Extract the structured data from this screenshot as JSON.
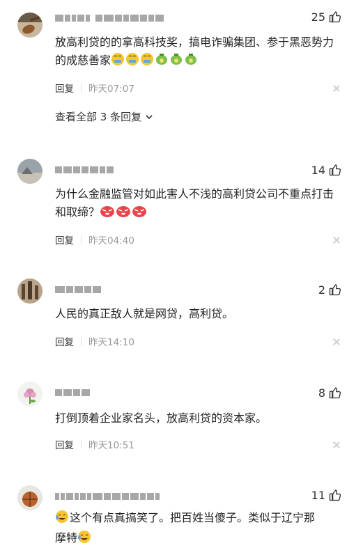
{
  "comments": [
    {
      "likes": "25",
      "text": "放高利贷的的拿高科技奖，搞电诈骗集团、参于黑恶势力的成慈善家",
      "reply_label": "回复",
      "time": "昨天07:07",
      "view_all_label": "查看全部 3 条回复"
    },
    {
      "likes": "14",
      "text": "为什么金融监管对如此害人不浅的高利贷公司不重点打击和取缔？",
      "reply_label": "回复",
      "time": "昨天04:40"
    },
    {
      "likes": "2",
      "text": "人民的真正敌人就是网贷，高利贷。",
      "reply_label": "回复",
      "time": "昨天14:10"
    },
    {
      "likes": "8",
      "text": "打倒顶着企业家名头，放高利贷的资本家。",
      "reply_label": "回复",
      "time": "昨天10:51"
    },
    {
      "likes": "11",
      "text_a": "这个有点真搞笑了。把百姓当傻子。类似于辽宁那",
      "text_b": "摩特"
    }
  ],
  "icons": {
    "like": "thumbs-up-icon",
    "close": "close-icon",
    "chevron": "chevron-down-icon"
  }
}
